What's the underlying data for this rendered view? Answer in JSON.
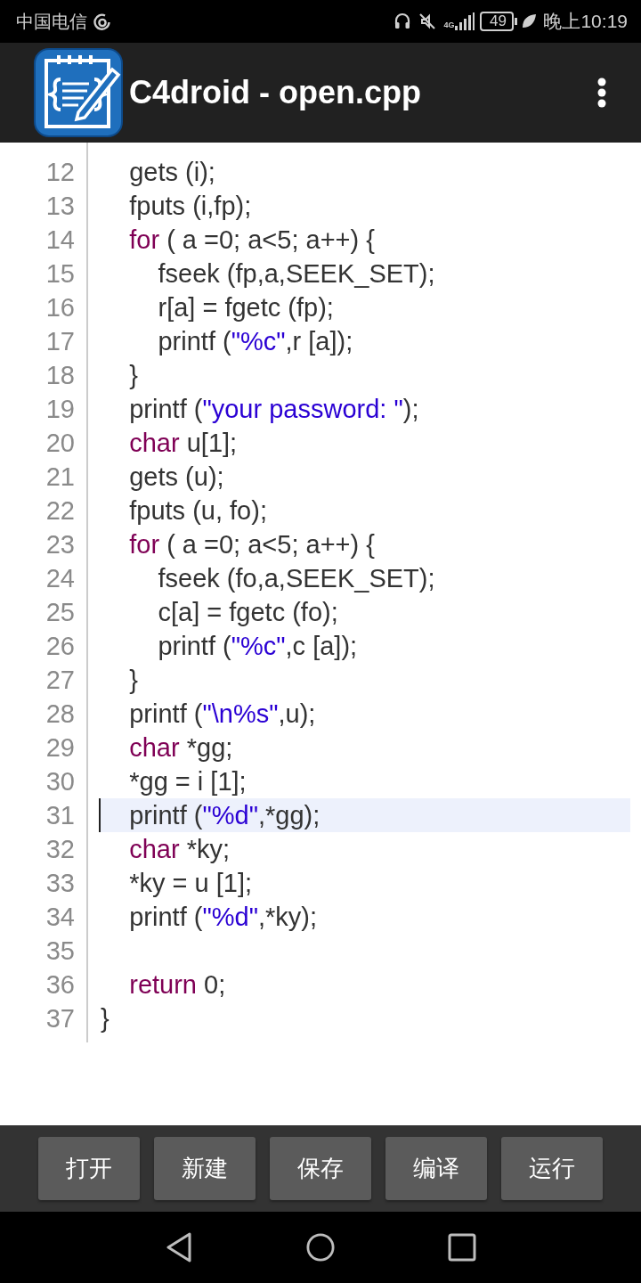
{
  "status_bar": {
    "carrier": "中国电信",
    "network_type": "4G",
    "battery": "49",
    "time": "晚上10:19"
  },
  "app_bar": {
    "title": "C4droid - open.cpp"
  },
  "editor": {
    "lines": [
      {
        "number": "12",
        "current": false,
        "tokens": [
          {
            "kind": "plain",
            "text": "    gets (i);"
          }
        ]
      },
      {
        "number": "13",
        "current": false,
        "tokens": [
          {
            "kind": "plain",
            "text": "    fputs (i,fp);"
          }
        ]
      },
      {
        "number": "14",
        "current": false,
        "tokens": [
          {
            "kind": "keyword",
            "text": "    for"
          },
          {
            "kind": "plain",
            "text": " ( a =0; a<5; a++) {"
          }
        ]
      },
      {
        "number": "15",
        "current": false,
        "tokens": [
          {
            "kind": "plain",
            "text": "        fseek (fp,a,SEEK_SET);"
          }
        ]
      },
      {
        "number": "16",
        "current": false,
        "tokens": [
          {
            "kind": "plain",
            "text": "        r[a] = fgetc (fp);"
          }
        ]
      },
      {
        "number": "17",
        "current": false,
        "tokens": [
          {
            "kind": "plain",
            "text": "        printf ("
          },
          {
            "kind": "string",
            "text": "\"%c\""
          },
          {
            "kind": "plain",
            "text": ",r [a]);"
          }
        ]
      },
      {
        "number": "18",
        "current": false,
        "tokens": [
          {
            "kind": "plain",
            "text": "    }"
          }
        ]
      },
      {
        "number": "19",
        "current": false,
        "tokens": [
          {
            "kind": "plain",
            "text": "    printf ("
          },
          {
            "kind": "string",
            "text": "\"your password: \""
          },
          {
            "kind": "plain",
            "text": ");"
          }
        ]
      },
      {
        "number": "20",
        "current": false,
        "tokens": [
          {
            "kind": "keyword",
            "text": "    char"
          },
          {
            "kind": "plain",
            "text": " u[1];"
          }
        ]
      },
      {
        "number": "21",
        "current": false,
        "tokens": [
          {
            "kind": "plain",
            "text": "    gets (u);"
          }
        ]
      },
      {
        "number": "22",
        "current": false,
        "tokens": [
          {
            "kind": "plain",
            "text": "    fputs (u, fo);"
          }
        ]
      },
      {
        "number": "23",
        "current": false,
        "tokens": [
          {
            "kind": "keyword",
            "text": "    for"
          },
          {
            "kind": "plain",
            "text": " ( a =0; a<5; a++) {"
          }
        ]
      },
      {
        "number": "24",
        "current": false,
        "tokens": [
          {
            "kind": "plain",
            "text": "        fseek (fo,a,SEEK_SET);"
          }
        ]
      },
      {
        "number": "25",
        "current": false,
        "tokens": [
          {
            "kind": "plain",
            "text": "        c[a] = fgetc (fo);"
          }
        ]
      },
      {
        "number": "26",
        "current": false,
        "tokens": [
          {
            "kind": "plain",
            "text": "        printf ("
          },
          {
            "kind": "string",
            "text": "\"%c\""
          },
          {
            "kind": "plain",
            "text": ",c [a]);"
          }
        ]
      },
      {
        "number": "27",
        "current": false,
        "tokens": [
          {
            "kind": "plain",
            "text": "    }"
          }
        ]
      },
      {
        "number": "28",
        "current": false,
        "tokens": [
          {
            "kind": "plain",
            "text": "    printf ("
          },
          {
            "kind": "string",
            "text": "\"\\n%s\""
          },
          {
            "kind": "plain",
            "text": ",u);"
          }
        ]
      },
      {
        "number": "29",
        "current": false,
        "tokens": [
          {
            "kind": "keyword",
            "text": "    char"
          },
          {
            "kind": "plain",
            "text": " *gg;"
          }
        ]
      },
      {
        "number": "30",
        "current": false,
        "tokens": [
          {
            "kind": "plain",
            "text": "    *gg = i [1];"
          }
        ]
      },
      {
        "number": "31",
        "current": true,
        "tokens": [
          {
            "kind": "plain",
            "text": "    printf ("
          },
          {
            "kind": "string",
            "text": "\"%d\""
          },
          {
            "kind": "plain",
            "text": ",*gg);"
          }
        ]
      },
      {
        "number": "32",
        "current": false,
        "tokens": [
          {
            "kind": "keyword",
            "text": "    char"
          },
          {
            "kind": "plain",
            "text": " *ky;"
          }
        ]
      },
      {
        "number": "33",
        "current": false,
        "tokens": [
          {
            "kind": "plain",
            "text": "    *ky = u [1];"
          }
        ]
      },
      {
        "number": "34",
        "current": false,
        "tokens": [
          {
            "kind": "plain",
            "text": "    printf ("
          },
          {
            "kind": "string",
            "text": "\"%d\""
          },
          {
            "kind": "plain",
            "text": ",*ky);"
          }
        ]
      },
      {
        "number": "35",
        "current": false
      },
      {
        "number": "36",
        "current": false,
        "tokens": [
          {
            "kind": "keyword",
            "text": "    return"
          },
          {
            "kind": "plain",
            "text": " 0;"
          }
        ]
      },
      {
        "number": "37",
        "current": false,
        "tokens": [
          {
            "kind": "plain",
            "text": "}"
          }
        ]
      }
    ]
  },
  "toolbar": {
    "buttons": [
      "打开",
      "新建",
      "保存",
      "编译",
      "运行"
    ]
  }
}
